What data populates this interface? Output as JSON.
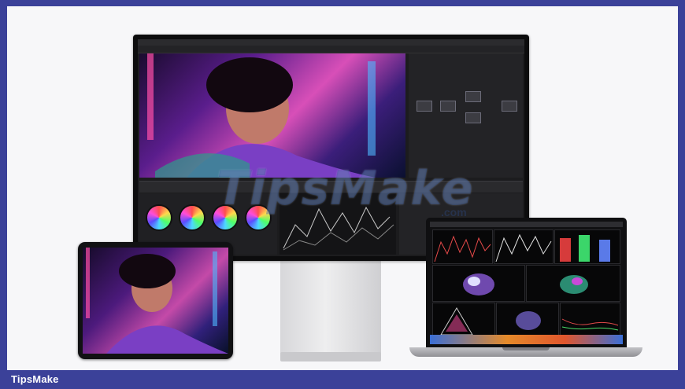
{
  "footer": {
    "brand": "TipsMake"
  },
  "watermark": {
    "text": "TipsMake",
    "sub": ".com"
  },
  "devices": {
    "display": {
      "icon": "pro-display-icon"
    },
    "ipad": {
      "icon": "ipad-icon"
    },
    "macbook": {
      "icon": "macbook-icon"
    }
  },
  "colors": {
    "frame": "#3b4199",
    "background": "#f7f7f9"
  }
}
